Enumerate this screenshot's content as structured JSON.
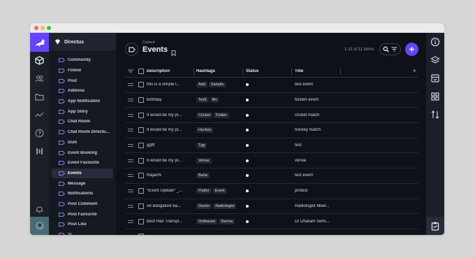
{
  "app": {
    "name": "Directus"
  },
  "colors": {
    "accent": "#6644ff",
    "background": "#0e1118"
  },
  "module_bar": {
    "items": [
      {
        "icon": "box-icon",
        "active": true
      },
      {
        "icon": "users-icon"
      },
      {
        "icon": "folder-icon"
      },
      {
        "icon": "activity-icon"
      },
      {
        "icon": "help-icon"
      },
      {
        "icon": "settings-icon"
      },
      {
        "icon": "bell-icon"
      }
    ]
  },
  "nav": {
    "items": [
      {
        "label": "Community"
      },
      {
        "label": "Follow"
      },
      {
        "label": "Post"
      },
      {
        "label": "Address"
      },
      {
        "label": "App Notification"
      },
      {
        "label": "App Story"
      },
      {
        "label": "Chat Room"
      },
      {
        "label": "Chat Room Directu..."
      },
      {
        "label": "Dum"
      },
      {
        "label": "Event Booking"
      },
      {
        "label": "Event Favourite"
      },
      {
        "label": "Events",
        "active": true
      },
      {
        "label": "Message"
      },
      {
        "label": "Notifications"
      },
      {
        "label": "Post Comment"
      },
      {
        "label": "Post Favourite"
      },
      {
        "label": "Post Like"
      },
      {
        "label": "Tr..."
      }
    ]
  },
  "header": {
    "breadcrumb": "Content",
    "title": "Events",
    "count": "1-11 of 11 items"
  },
  "table": {
    "columns": [
      "Description",
      "Hashtags",
      "Status",
      "Title"
    ],
    "rows": [
      {
        "description": "this is a simple t...",
        "hashtags": [
          "Add",
          "Sample"
        ],
        "title": "test event"
      },
      {
        "description": "birthday",
        "hashtags": [
          "Tes5",
          "Bit"
        ],
        "title": "bishen event"
      },
      {
        "description": "It would be my pl...",
        "hashtags": [
          "Cricket",
          "Flutter"
        ],
        "title": "cricket match"
      },
      {
        "description": "It would be my pl...",
        "hashtags": [
          "Hockey"
        ],
        "title": "hockey match"
      },
      {
        "description": "ggfff",
        "hashtags": [
          "Tgg"
        ],
        "title": "test"
      },
      {
        "description": "It would be my pl...",
        "hashtags": [
          "Venue"
        ],
        "title": "venue"
      },
      {
        "description": "thajanN",
        "hashtags": [
          "Baha"
        ],
        "title": "test event"
      },
      {
        "description": "*Event Update* _...",
        "hashtags": [
          "Flutter",
          "Event"
        ],
        "title": "protest"
      },
      {
        "description": "All Bangalore ba...",
        "hashtags": [
          "Doctor",
          "Radiologist"
        ],
        "title": "Radiologist Meet..."
      },
      {
        "description": "Best Hair Transpl...",
        "hashtags": [
          "Drdharam",
          "Derma"
        ],
        "title": "Dr Dharam Semi..."
      },
      {
        "description": "",
        "hashtags": [],
        "title": ""
      }
    ]
  },
  "sidebar": {
    "items": [
      {
        "icon": "info-icon"
      },
      {
        "icon": "layers-icon"
      },
      {
        "icon": "bookmark-import-icon"
      },
      {
        "icon": "dashboard-icon"
      },
      {
        "icon": "sort-icon"
      },
      {
        "icon": "clipboard-icon"
      }
    ]
  }
}
